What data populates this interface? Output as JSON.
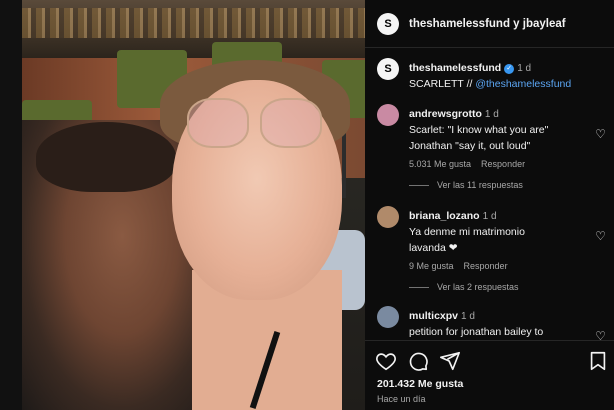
{
  "header": {
    "title": "theshamelessfund y jbayleaf",
    "avatar_letter": "S"
  },
  "caption": {
    "username": "theshamelessfund",
    "time": "1 d",
    "text_prefix": "SCARLETT // ",
    "mention": "@theshamelessfund"
  },
  "comments": [
    {
      "username": "andrewsgrotto",
      "time": "1 d",
      "lines": [
        "Scarlet: \"I know what you are\"",
        "Jonathan \"say it, out loud\""
      ],
      "likes": "5.031 Me gusta",
      "reply": "Responder",
      "replies": "Ver las 11 respuestas",
      "avatar_color": "#c98aa3"
    },
    {
      "username": "briana_lozano",
      "time": "1 d",
      "lines": [
        "Ya denme mi matrimonio",
        "lavanda ❤"
      ],
      "likes": "9 Me gusta",
      "reply": "Responder",
      "replies": "Ver las 2 respuestas",
      "avatar_color": "#b08a6a"
    },
    {
      "username": "multicxpv",
      "time": "1 d",
      "lines": [
        "petition for jonathan bailey to"
      ],
      "avatar_color": "#7a8aa0"
    }
  ],
  "footer": {
    "likes": "201.432 Me gusta",
    "time_ago": "Hace un día"
  },
  "icons": {
    "like": "heart-icon",
    "comment": "comment-icon",
    "share": "share-icon",
    "save": "bookmark-icon"
  },
  "colors": {
    "accent": "#3897f0",
    "mention": "#5ba5f2",
    "love": "#ed4956"
  }
}
